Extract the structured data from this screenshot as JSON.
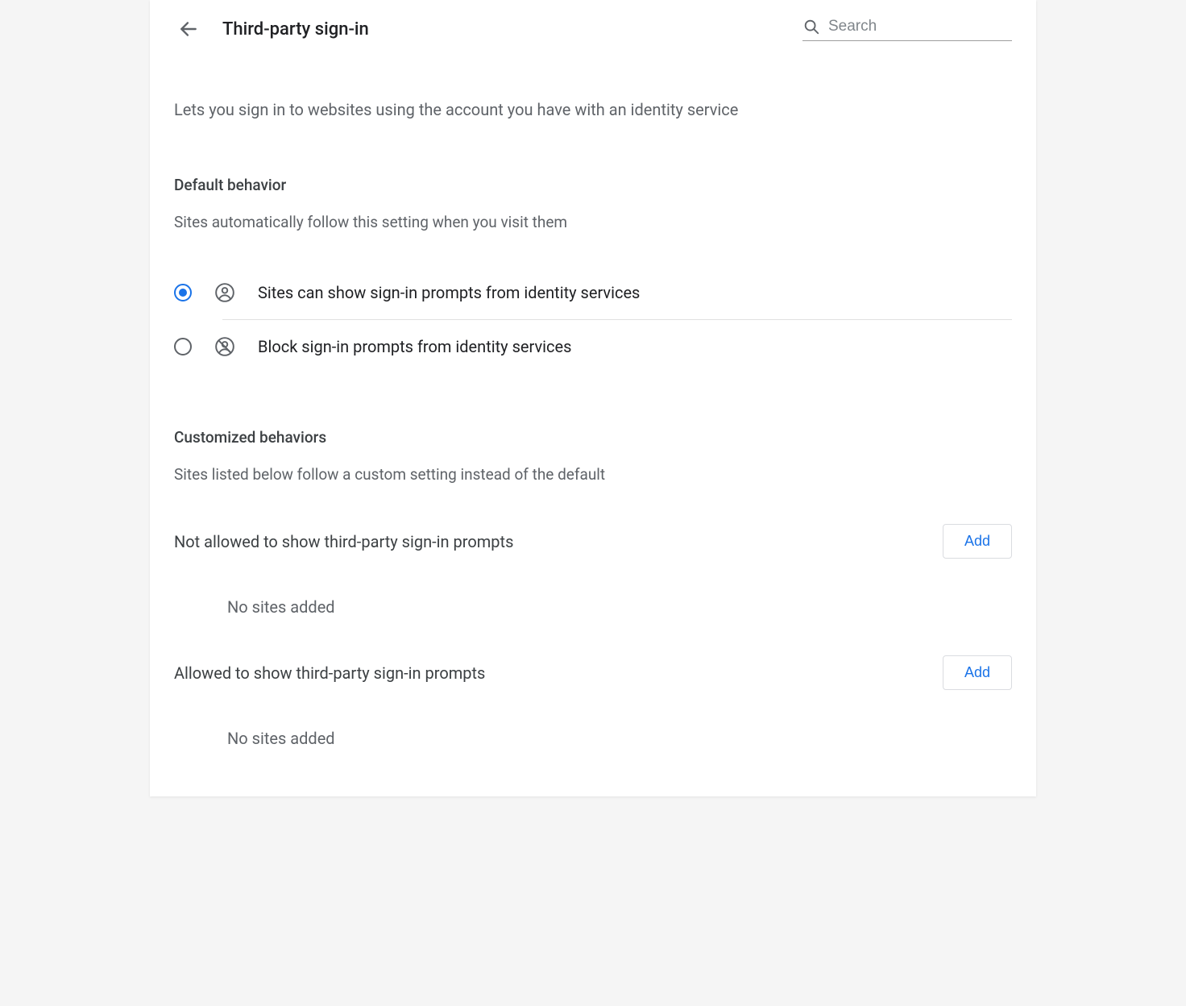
{
  "header": {
    "title": "Third-party sign-in"
  },
  "search": {
    "placeholder": "Search"
  },
  "intro": "Lets you sign in to websites using the account you have with an identity service",
  "default_section": {
    "title": "Default behavior",
    "subtitle": "Sites automatically follow this setting when you visit them",
    "options": {
      "allow": "Sites can show sign-in prompts from identity services",
      "block": "Block sign-in prompts from identity services"
    }
  },
  "custom_section": {
    "title": "Customized behaviors",
    "subtitle": "Sites listed below follow a custom setting instead of the default",
    "not_allowed": {
      "label": "Not allowed to show third-party sign-in prompts",
      "add": "Add",
      "empty": "No sites added"
    },
    "allowed": {
      "label": "Allowed to show third-party sign-in prompts",
      "add": "Add",
      "empty": "No sites added"
    }
  }
}
